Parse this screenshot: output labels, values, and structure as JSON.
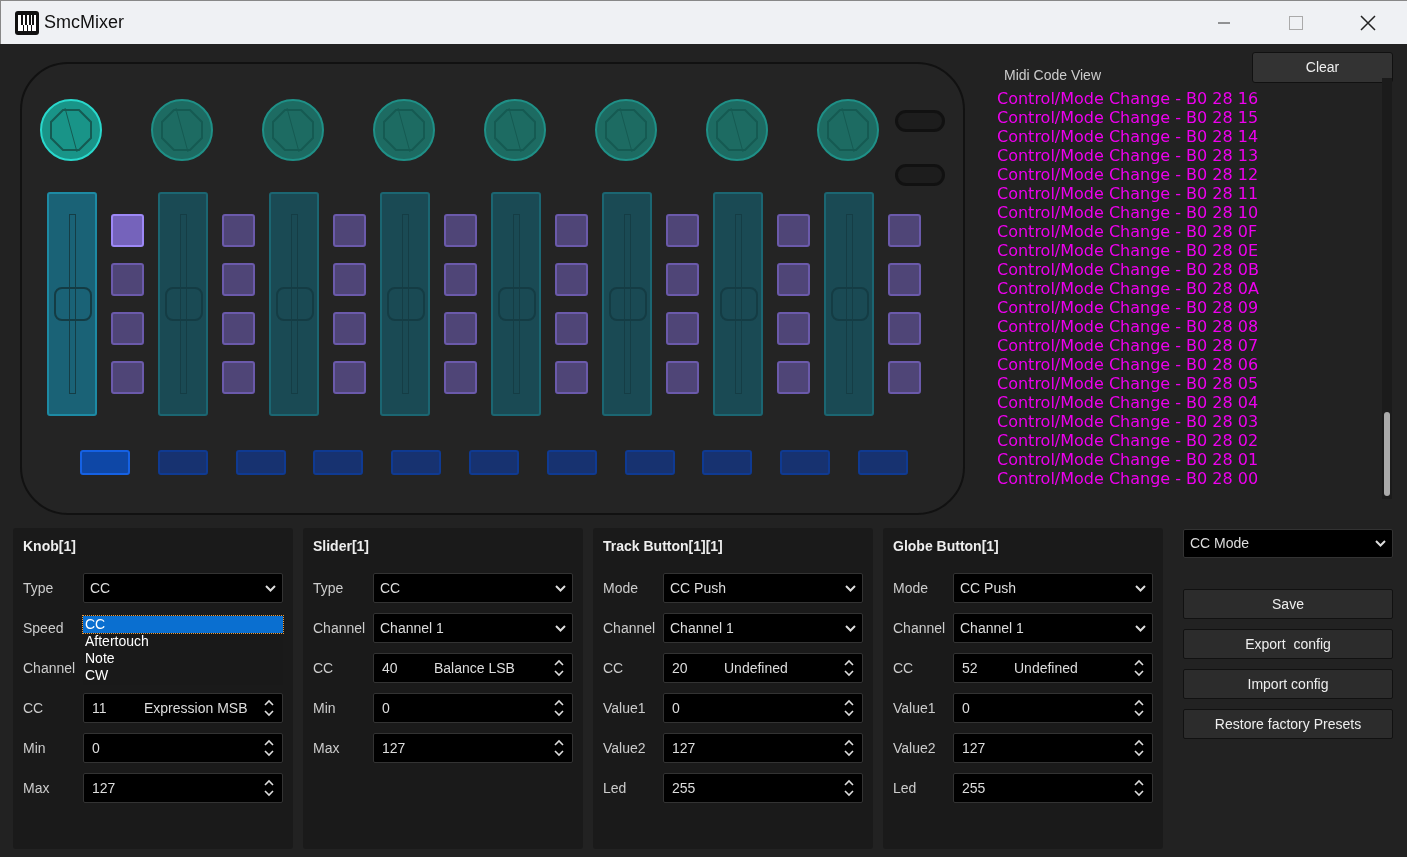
{
  "window": {
    "title": "SmcMixer"
  },
  "device": {
    "knobs": [
      {
        "selected": true
      },
      {
        "selected": false
      },
      {
        "selected": false
      },
      {
        "selected": false
      },
      {
        "selected": false
      },
      {
        "selected": false
      },
      {
        "selected": false
      },
      {
        "selected": false
      }
    ],
    "sliders": [
      {
        "selected": true,
        "level": 0.5
      },
      {
        "selected": false,
        "level": 0.5
      },
      {
        "selected": false,
        "level": 0.5
      },
      {
        "selected": false,
        "level": 0.5
      },
      {
        "selected": false,
        "level": 0.5
      },
      {
        "selected": false,
        "level": 0.5
      },
      {
        "selected": false,
        "level": 0.5
      },
      {
        "selected": false,
        "level": 0.5
      }
    ],
    "pads": [
      [
        {
          "selected": true
        },
        {
          "selected": false
        },
        {
          "selected": false
        },
        {
          "selected": false
        }
      ],
      [
        {
          "selected": false
        },
        {
          "selected": false
        },
        {
          "selected": false
        },
        {
          "selected": false
        }
      ],
      [
        {
          "selected": false
        },
        {
          "selected": false
        },
        {
          "selected": false
        },
        {
          "selected": false
        }
      ],
      [
        {
          "selected": false
        },
        {
          "selected": false
        },
        {
          "selected": false
        },
        {
          "selected": false
        }
      ],
      [
        {
          "selected": false
        },
        {
          "selected": false
        },
        {
          "selected": false
        },
        {
          "selected": false
        }
      ],
      [
        {
          "selected": false
        },
        {
          "selected": false
        },
        {
          "selected": false
        },
        {
          "selected": false
        }
      ],
      [
        {
          "selected": false
        },
        {
          "selected": false
        },
        {
          "selected": false
        },
        {
          "selected": false
        }
      ],
      [
        {
          "selected": false
        },
        {
          "selected": false
        },
        {
          "selected": false
        },
        {
          "selected": false
        }
      ]
    ],
    "bottom_buttons": [
      {
        "selected": true
      },
      {
        "selected": false
      },
      {
        "selected": false
      },
      {
        "selected": false
      },
      {
        "selected": false
      },
      {
        "selected": false
      },
      {
        "selected": false
      },
      {
        "selected": false
      },
      {
        "selected": false
      },
      {
        "selected": false
      },
      {
        "selected": false
      }
    ]
  },
  "midi_view": {
    "title": "Midi Code View",
    "clear_button": "Clear",
    "lines": [
      "Control/Mode Change - B0 28 16",
      "Control/Mode Change - B0 28 15",
      "Control/Mode Change - B0 28 14",
      "Control/Mode Change - B0 28 13",
      "Control/Mode Change - B0 28 12",
      "Control/Mode Change - B0 28 11",
      "Control/Mode Change - B0 28 10",
      "Control/Mode Change - B0 28 0F",
      "Control/Mode Change - B0 28 0E",
      "Control/Mode Change - B0 28 0B",
      "Control/Mode Change - B0 28 0A",
      "Control/Mode Change - B0 28 09",
      "Control/Mode Change - B0 28 08",
      "Control/Mode Change - B0 28 07",
      "Control/Mode Change - B0 28 06",
      "Control/Mode Change - B0 28 05",
      "Control/Mode Change - B0 28 04",
      "Control/Mode Change - B0 28 03",
      "Control/Mode Change - B0 28 02",
      "Control/Mode Change - B0 28 01",
      "Control/Mode Change - B0 28 00"
    ]
  },
  "panels": [
    {
      "title": "Knob[1]",
      "rows": [
        {
          "label": "Type",
          "kind": "select",
          "value": "CC",
          "options": [
            {
              "label": "CC",
              "selected": true
            },
            {
              "label": "Aftertouch",
              "selected": false
            },
            {
              "label": "Note",
              "selected": false
            },
            {
              "label": "CW",
              "selected": false
            }
          ]
        },
        {
          "label": "Speed",
          "kind": "covered"
        },
        {
          "label": "Channel",
          "kind": "select"
        },
        {
          "label": "CC",
          "kind": "spin",
          "value": "11",
          "note": "Expression MSB"
        },
        {
          "label": "Min",
          "kind": "spin",
          "value": "0"
        },
        {
          "label": "Max",
          "kind": "spin",
          "value": "127"
        }
      ]
    },
    {
      "title": "Slider[1]",
      "rows": [
        {
          "label": "Type",
          "kind": "select",
          "value": "CC"
        },
        {
          "label": "Channel",
          "kind": "select",
          "value": "Channel 1"
        },
        {
          "label": "CC",
          "kind": "spin",
          "value": "40",
          "note": "Balance LSB"
        },
        {
          "label": "Min",
          "kind": "spin",
          "value": "0"
        },
        {
          "label": "Max",
          "kind": "spin",
          "value": "127"
        }
      ]
    },
    {
      "title": "Track Button[1][1]",
      "rows": [
        {
          "label": "Mode",
          "kind": "select",
          "value": "CC Push"
        },
        {
          "label": "Channel",
          "kind": "select",
          "value": "Channel 1"
        },
        {
          "label": "CC",
          "kind": "spin",
          "value": "20",
          "note": "Undefined"
        },
        {
          "label": "Value1",
          "kind": "spin",
          "value": "0"
        },
        {
          "label": "Value2",
          "kind": "spin",
          "value": "127"
        },
        {
          "label": "Led",
          "kind": "spin",
          "value": "255"
        }
      ]
    },
    {
      "title": "Globe Button[1]",
      "rows": [
        {
          "label": "Mode",
          "kind": "select",
          "value": "CC Push"
        },
        {
          "label": "Channel",
          "kind": "select",
          "value": "Channel 1"
        },
        {
          "label": "CC",
          "kind": "spin",
          "value": "52",
          "note": "Undefined"
        },
        {
          "label": "Value1",
          "kind": "spin",
          "value": "0"
        },
        {
          "label": "Value2",
          "kind": "spin",
          "value": "127"
        },
        {
          "label": "Led",
          "kind": "spin",
          "value": "255"
        }
      ]
    }
  ],
  "mode_select": {
    "value": "CC Mode"
  },
  "actions": [
    "Save",
    "Export  config",
    "Import config",
    "Restore factory Presets"
  ]
}
